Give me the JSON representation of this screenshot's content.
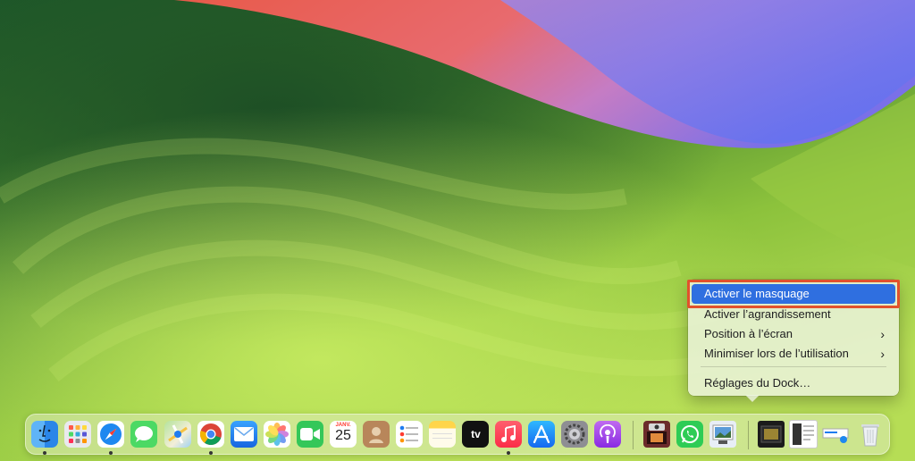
{
  "context_menu": {
    "items": [
      {
        "label": "Activer le masquage",
        "selected": true,
        "submenu": false
      },
      {
        "label": "Activer l’agrandissement",
        "selected": false,
        "submenu": false
      },
      {
        "label": "Position à l’écran",
        "selected": false,
        "submenu": true
      },
      {
        "label": "Minimiser lors de l’utilisation",
        "selected": false,
        "submenu": true
      },
      {
        "label": "Réglages du Dock…",
        "selected": false,
        "submenu": false
      }
    ],
    "chevron": "›",
    "highlight_color": "#e2512c",
    "selection_color": "#2f6fe0"
  },
  "dock": {
    "calendar": {
      "month": "JANV.",
      "day": "25"
    },
    "tv_label": "tv",
    "apps": [
      {
        "name": "finder-icon",
        "running": true
      },
      {
        "name": "launchpad-icon",
        "running": false
      },
      {
        "name": "safari-icon",
        "running": true
      },
      {
        "name": "messages-icon",
        "running": false
      },
      {
        "name": "maps-icon",
        "running": false
      },
      {
        "name": "chrome-icon",
        "running": true
      },
      {
        "name": "mail-icon",
        "running": false
      },
      {
        "name": "photos-icon",
        "running": false
      },
      {
        "name": "facetime-icon",
        "running": false
      },
      {
        "name": "calendar-icon",
        "running": false
      },
      {
        "name": "contacts-icon",
        "running": false
      },
      {
        "name": "reminders-icon",
        "running": false
      },
      {
        "name": "notes-icon",
        "running": false
      },
      {
        "name": "apple-tv-icon",
        "running": false
      },
      {
        "name": "music-icon",
        "running": true
      },
      {
        "name": "app-store-icon",
        "running": false
      },
      {
        "name": "system-settings-icon",
        "running": false
      },
      {
        "name": "podcasts-icon",
        "running": false
      },
      {
        "name": "photo-booth-icon",
        "running": false
      },
      {
        "name": "whatsapp-icon",
        "running": false
      },
      {
        "name": "preview-icon",
        "running": false
      },
      {
        "name": "minimized-window-icon",
        "running": false
      },
      {
        "name": "document-window-icon",
        "running": false
      },
      {
        "name": "downloads-stack-icon",
        "running": false
      },
      {
        "name": "trash-icon",
        "running": false
      }
    ]
  }
}
